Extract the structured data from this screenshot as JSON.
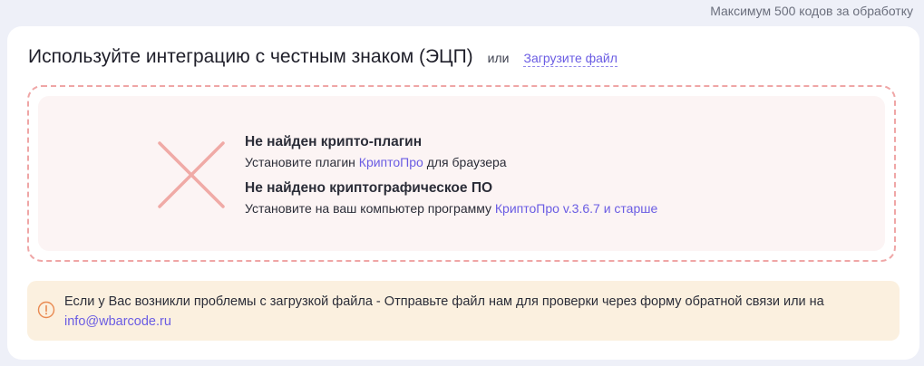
{
  "limit_note": "Максимум 500 кодов за обработку",
  "header": {
    "title": "Используйте интеграцию с честным знаком (ЭЦП)",
    "or": "или",
    "upload_link": "Загрузите файл"
  },
  "errors": [
    {
      "title": "Не найден крипто-плагин",
      "text_before": "Установите плагин ",
      "link": "КриптоПро",
      "text_after": " для браузера"
    },
    {
      "title": "Не найдено криптографическое ПО",
      "text_before": "Установите на ваш компьютер программу ",
      "link": "КриптоПро v.3.6.7 и старше",
      "text_after": ""
    }
  ],
  "alert": {
    "text": "Если у Вас возникли проблемы с загрузкой файла - Отправьте файл нам для проверки через форму обратной связи или на ",
    "email": "info@wbarcode.ru"
  },
  "icons": {
    "error": "close-x-icon",
    "alert": "info-circle-icon"
  },
  "colors": {
    "accent": "#6a5ce3",
    "error_cross": "#f0aaa6",
    "drop_border": "#efa6a6",
    "alert_bg": "#fbf0df",
    "alert_icon": "#e98a52"
  }
}
